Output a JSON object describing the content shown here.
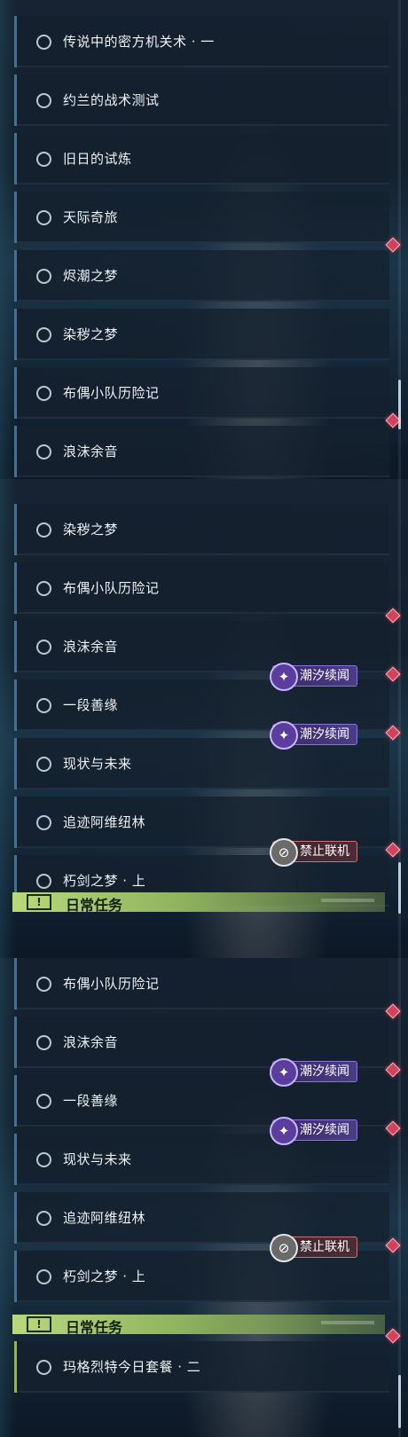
{
  "panels": [
    {
      "rows": [
        {
          "label": "传说中的密方机关术 · 一"
        },
        {
          "label": "约兰的战术测试"
        },
        {
          "label": "旧日的试炼"
        },
        {
          "label": "天际奇旅"
        },
        {
          "label": "烬潮之梦"
        },
        {
          "label": "染秽之梦"
        },
        {
          "label": "布偶小队历险记"
        },
        {
          "label": "浪沫余音"
        }
      ]
    },
    {
      "rows": [
        {
          "label": "染秽之梦"
        },
        {
          "label": "布偶小队历险记"
        },
        {
          "label": "浪沫余音"
        },
        {
          "label": "一段善缘"
        },
        {
          "label": "现状与未来"
        },
        {
          "label": "追迹阿维纽林"
        },
        {
          "label": "朽剑之梦 · 上"
        }
      ],
      "daily_label": "日常任务"
    },
    {
      "rows": [
        {
          "label": "布偶小队历险记"
        },
        {
          "label": "浪沫余音"
        },
        {
          "label": "一段善缘"
        },
        {
          "label": "现状与未来"
        },
        {
          "label": "追迹阿维纽林"
        },
        {
          "label": "朽剑之梦 · 上"
        },
        {
          "label": "玛格烈特今日套餐 · 二"
        }
      ],
      "daily_label": "日常任务"
    }
  ],
  "badges": {
    "tide": "潮汐续闻",
    "ban": "禁止联机"
  },
  "icons": {
    "daily": "!",
    "tide": "✦",
    "ban": "⊘"
  },
  "colors": {
    "accent_red": "#d2425a",
    "daily_green": "#b9d87a",
    "tide_purple": "#4a3c86"
  }
}
